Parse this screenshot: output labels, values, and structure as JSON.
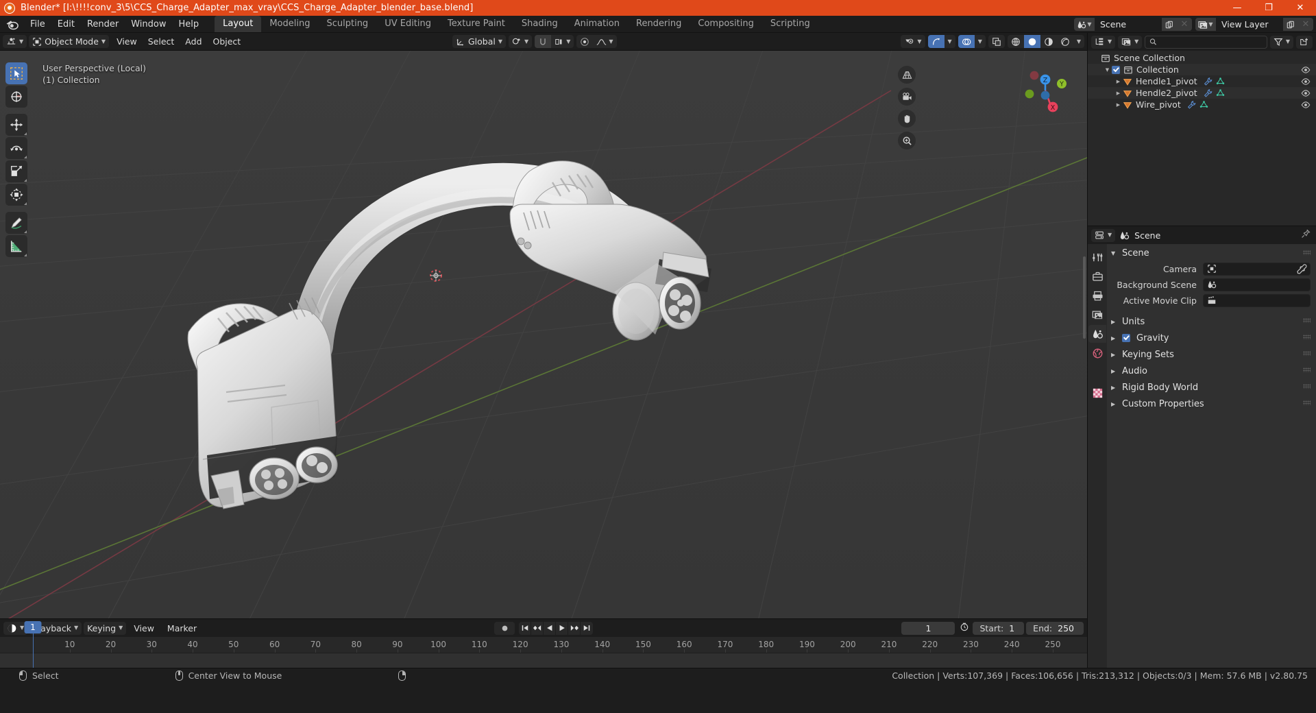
{
  "window": {
    "title": "Blender* [I:\\!!!!conv_3\\5\\CCS_Charge_Adapter_max_vray\\CCS_Charge_Adapter_blender_base.blend]",
    "minimize": "—",
    "maximize": "❐",
    "close": "✕",
    "accent_color": "#e0491a"
  },
  "topbar": {
    "menus": [
      "File",
      "Edit",
      "Render",
      "Window",
      "Help"
    ],
    "workspaces": [
      {
        "label": "Layout",
        "active": true
      },
      {
        "label": "Modeling",
        "active": false
      },
      {
        "label": "Sculpting",
        "active": false
      },
      {
        "label": "UV Editing",
        "active": false
      },
      {
        "label": "Texture Paint",
        "active": false
      },
      {
        "label": "Shading",
        "active": false
      },
      {
        "label": "Animation",
        "active": false
      },
      {
        "label": "Rendering",
        "active": false
      },
      {
        "label": "Compositing",
        "active": false
      },
      {
        "label": "Scripting",
        "active": false
      }
    ],
    "scene_name": "Scene",
    "view_layer_name": "View Layer",
    "new_copy_label": "❐",
    "unlink_label": "✕"
  },
  "viewport_header": {
    "mode": "Object Mode",
    "menus": [
      "View",
      "Select",
      "Add",
      "Object"
    ],
    "transform_orientation": "Global",
    "shading": {
      "active": "solid",
      "modes": [
        "wireframe",
        "solid",
        "material-preview",
        "rendered"
      ]
    }
  },
  "viewport": {
    "perspective_label": "User Perspective (Local)",
    "collection_label": "(1) Collection",
    "gizmo_axes": [
      {
        "label": "Z",
        "color": "#3993e8"
      },
      {
        "label": "Y",
        "color": "#8fbf2a"
      },
      {
        "label": "X",
        "color": "#e8415c"
      }
    ],
    "nav_buttons": [
      "grid-persp-icon",
      "camera-view-icon",
      "pan-view-icon",
      "zoom-view-icon"
    ],
    "tools": [
      {
        "name": "tweak-select-box",
        "active": true
      },
      {
        "name": "cursor",
        "active": false
      },
      {
        "name": "move",
        "active": false
      },
      {
        "name": "rotate",
        "active": false
      },
      {
        "name": "scale",
        "active": false
      },
      {
        "name": "transform",
        "active": false
      },
      {
        "name": "annotate",
        "active": false
      },
      {
        "name": "measure",
        "active": false
      }
    ]
  },
  "timeline": {
    "menus": [
      "Playback",
      "Keying",
      "View",
      "Marker"
    ],
    "current_frame": "1",
    "start_label": "Start:",
    "start_value": "1",
    "end_label": "End:",
    "end_value": "250",
    "ticks": [
      "10",
      "20",
      "30",
      "40",
      "50",
      "60",
      "70",
      "80",
      "90",
      "100",
      "110",
      "120",
      "130",
      "140",
      "150",
      "160",
      "170",
      "180",
      "190",
      "200",
      "210",
      "220",
      "230",
      "240",
      "250"
    ],
    "playhead_label": "1",
    "transport": [
      "jump-start-icon",
      "prev-keyframe-icon",
      "play-reverse-icon",
      "play-icon",
      "next-keyframe-icon",
      "jump-end-icon"
    ],
    "record_icon": "record-icon"
  },
  "outliner": {
    "search_placeholder": "",
    "filter_icon": "filter-icon",
    "new_collection_icon": "new-collection-icon",
    "rows": [
      {
        "label": "Scene Collection",
        "indent": 0,
        "icon": "collection-icon",
        "disclosure": "",
        "checkbox": false,
        "has_modifier": false,
        "has_mesh": false,
        "eye": false
      },
      {
        "label": "Collection",
        "indent": 1,
        "icon": "collection-icon",
        "disclosure": "down",
        "checkbox": true,
        "has_modifier": false,
        "has_mesh": false,
        "eye": true
      },
      {
        "label": "Hendle1_pivot",
        "indent": 2,
        "icon": "empty-cone-icon",
        "disclosure": "right",
        "checkbox": false,
        "has_modifier": true,
        "has_mesh": true,
        "eye": true
      },
      {
        "label": "Hendle2_pivot",
        "indent": 2,
        "icon": "empty-cone-icon",
        "disclosure": "right",
        "checkbox": false,
        "has_modifier": true,
        "has_mesh": true,
        "eye": true
      },
      {
        "label": "Wire_pivot",
        "indent": 2,
        "icon": "empty-cone-icon",
        "disclosure": "right",
        "checkbox": false,
        "has_modifier": true,
        "has_mesh": true,
        "eye": true
      }
    ]
  },
  "properties": {
    "breadcrumb": "Scene",
    "pin_icon": "pin-icon",
    "tabs": [
      "tool-icon",
      "render-icon",
      "output-icon",
      "view-layer-icon",
      "scene-icon",
      "world-icon",
      "texture-icon"
    ],
    "active_tab_index": 4,
    "panel_title": "Scene",
    "fields": [
      {
        "label": "Camera",
        "value": "",
        "icon": "camera-data-icon",
        "eyedropper": true
      },
      {
        "label": "Background Scene",
        "value": "",
        "icon": "scene-icon",
        "eyedropper": false
      },
      {
        "label": "Active Movie Clip",
        "value": "",
        "icon": "clip-icon",
        "eyedropper": false
      }
    ],
    "sections": [
      {
        "label": "Units",
        "checkbox": null
      },
      {
        "label": "Gravity",
        "checkbox": true
      },
      {
        "label": "Keying Sets",
        "checkbox": null
      },
      {
        "label": "Audio",
        "checkbox": null
      },
      {
        "label": "Rigid Body World",
        "checkbox": null
      },
      {
        "label": "Custom Properties",
        "checkbox": null
      }
    ]
  },
  "statusbar": {
    "hint_select": "Select",
    "hint_center": "Center View to Mouse",
    "stats": "Collection | Verts:107,369 | Faces:106,656 | Tris:213,312 | Objects:0/3 | Mem: 57.6 MB | v2.80.75"
  }
}
